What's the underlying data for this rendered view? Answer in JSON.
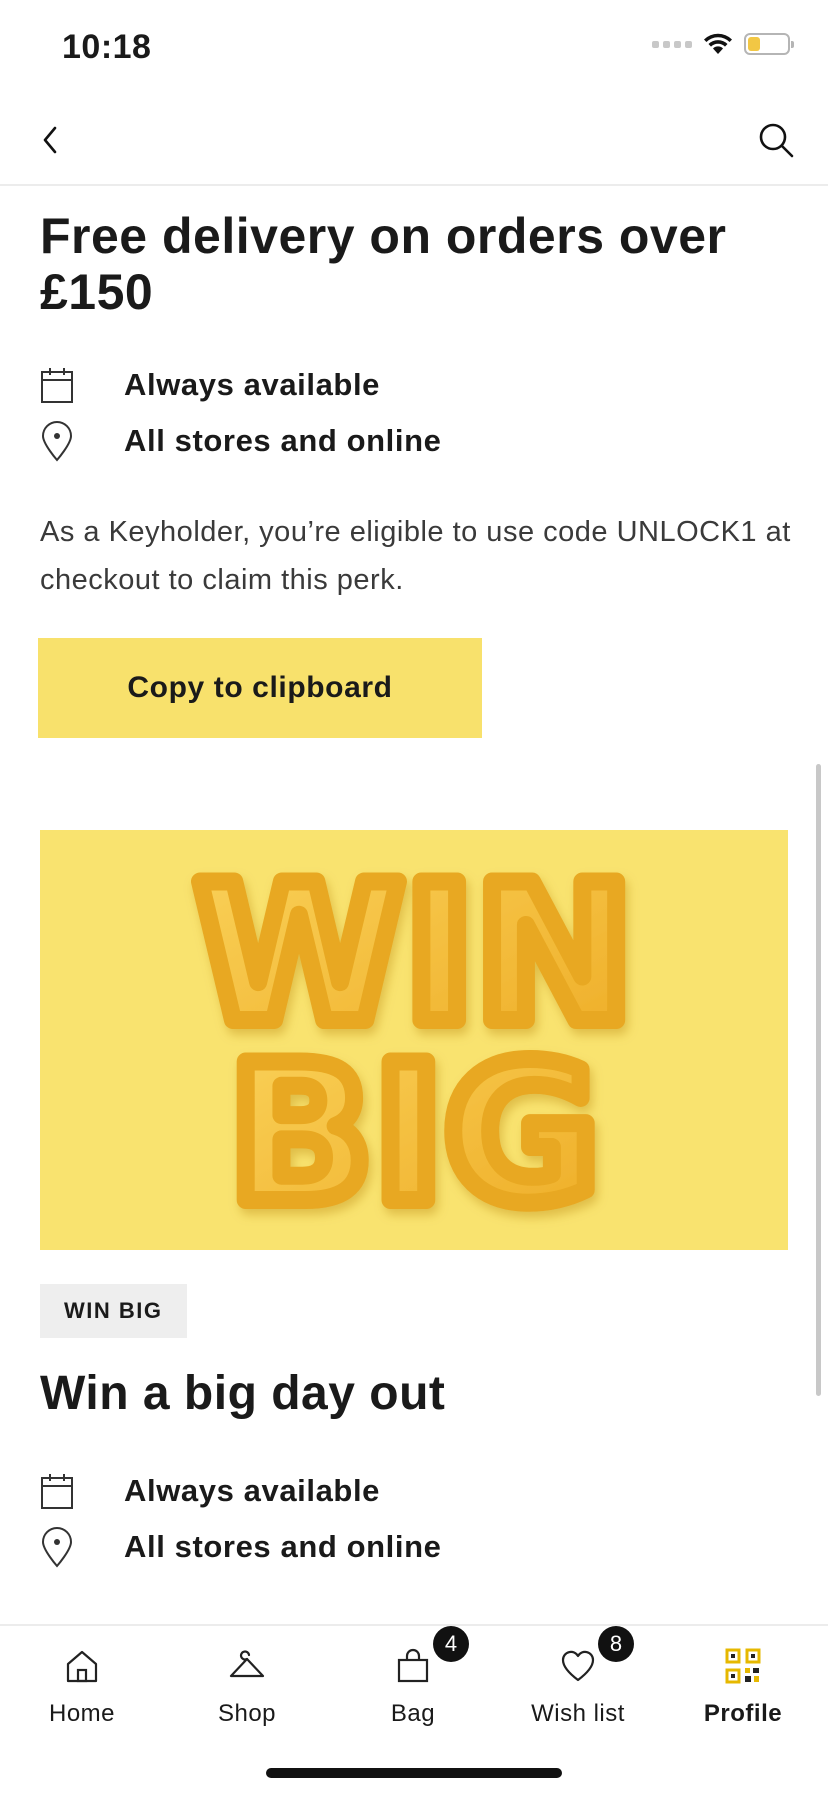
{
  "status_bar": {
    "time": "10:18"
  },
  "perk1": {
    "title": "Free delivery on orders over £150",
    "availability": "Always available",
    "location": "All stores and online",
    "description": "As a Keyholder, you’re eligible to use code UNLOCK1 at checkout to claim this perk.",
    "button_label": "Copy to clipboard"
  },
  "perk2": {
    "banner_text": [
      "WIN",
      "BIG"
    ],
    "badge": "WIN BIG",
    "title": "Win a big day out",
    "availability": "Always available",
    "location": "All stores and online"
  },
  "tab_bar": {
    "home": "Home",
    "shop": "Shop",
    "bag": "Bag",
    "bag_count": "4",
    "wishlist": "Wish list",
    "wishlist_count": "8",
    "profile": "Profile"
  },
  "colors": {
    "accent_yellow": "#f8e16c",
    "banner_bg": "#f9e36f",
    "banner_letters": "#f2b62e",
    "battery": "#f2c744"
  },
  "icons": [
    "back-chevron-icon",
    "search-icon",
    "calendar-icon",
    "location-pin-icon",
    "home-icon",
    "hanger-icon",
    "bag-icon",
    "heart-icon",
    "qr-code-icon"
  ]
}
